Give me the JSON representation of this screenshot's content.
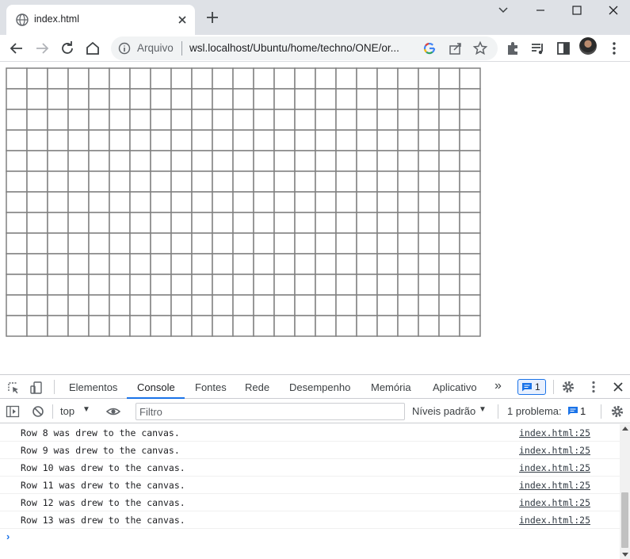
{
  "browser": {
    "tab_title": "index.html",
    "secure_label": "Arquivo",
    "url": "wsl.localhost/Ubuntu/home/techno/ONE/or..."
  },
  "page": {
    "grid": {
      "columns": 23,
      "rows": 13,
      "line_color": "#808080"
    }
  },
  "devtools": {
    "tabs": [
      "Elementos",
      "Console",
      "Fontes",
      "Rede",
      "Desempenho",
      "Memória",
      "Aplicativo"
    ],
    "active_tab": "Console",
    "more_tabs_glyph": "»",
    "message_badge_count": "1",
    "context": "top",
    "filter_placeholder": "Filtro",
    "levels_label": "Níveis padrão",
    "issues_label": "1 problema:",
    "issues_count": "1",
    "accent_color": "#1a73e8",
    "console_rows": [
      {
        "message": "Row 8 was drew to the canvas.",
        "source": "index.html:25"
      },
      {
        "message": "Row 9 was drew to the canvas.",
        "source": "index.html:25"
      },
      {
        "message": "Row 10 was drew to the canvas.",
        "source": "index.html:25"
      },
      {
        "message": "Row 11 was drew to the canvas.",
        "source": "index.html:25"
      },
      {
        "message": "Row 12 was drew to the canvas.",
        "source": "index.html:25"
      },
      {
        "message": "Row 13 was drew to the canvas.",
        "source": "index.html:25"
      }
    ],
    "prompt_glyph": "›"
  }
}
